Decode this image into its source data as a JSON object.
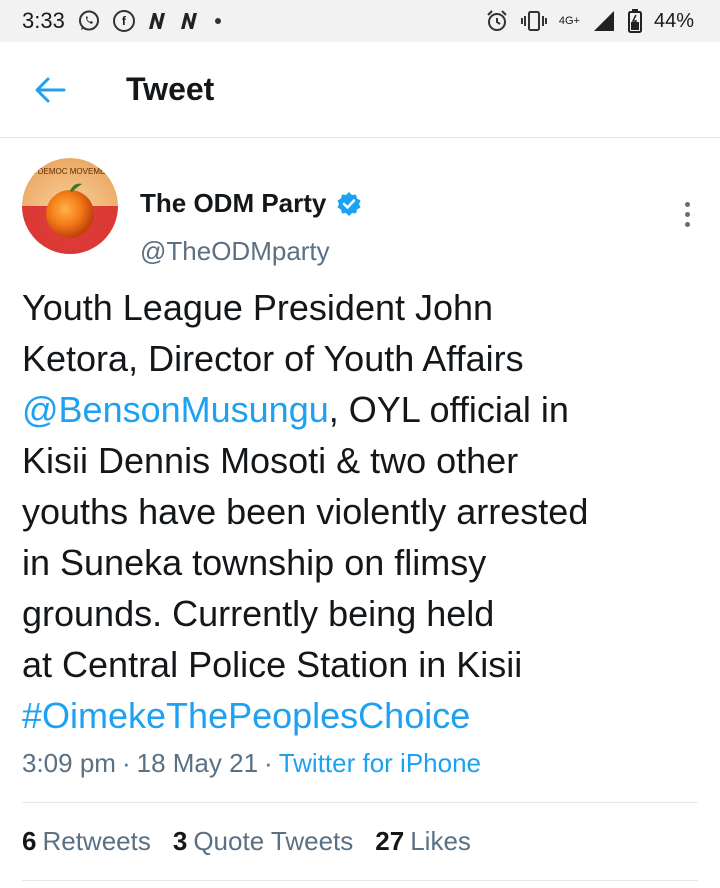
{
  "status_bar": {
    "time": "3:33",
    "notification_icons": [
      "whatsapp-icon",
      "facebook-icon",
      "n-app-icon",
      "n-app-icon",
      "more-notifications-dot-icon"
    ],
    "network": "4G+",
    "battery": "44%"
  },
  "header": {
    "title": "Tweet",
    "back_icon": "arrow-left-icon"
  },
  "tweet": {
    "author_name": "The ODM Party",
    "author_handle": "@TheODMparty",
    "avatar_text": "GE DEMOC MOVEMENT",
    "text_lines": [
      [
        "Youth League President John"
      ],
      [
        "Ketora, Director of Youth Affairs"
      ],
      [
        "@BensonMusungu",
        ", OYL official in"
      ],
      [
        "Kisii Dennis Mosoti & two other"
      ],
      [
        "youths have been violently arrested"
      ],
      [
        "in Suneka township on flimsy"
      ],
      [
        "grounds. Currently being held"
      ],
      [
        "at Central Police Station in Kisii"
      ],
      [
        "#OimekeThePeoplesChoice"
      ]
    ],
    "mention": "@BensonMusungu",
    "line3_rest": ", OYL official in",
    "hashtag": "#OimekeThePeoplesChoice",
    "time": "3:09 pm",
    "separator": "·",
    "date": "18 May 21",
    "source": "Twitter for iPhone"
  },
  "stats": {
    "retweets_count": "6",
    "retweets_label": "Retweets",
    "quotes_count": "3",
    "quotes_label": "Quote Tweets",
    "likes_count": "27",
    "likes_label": "Likes"
  },
  "colors": {
    "accent": "#1da1f2",
    "secondary_text": "#5b7083",
    "primary_text": "#14171a",
    "status_bar_bg": "#f2f2f2"
  }
}
